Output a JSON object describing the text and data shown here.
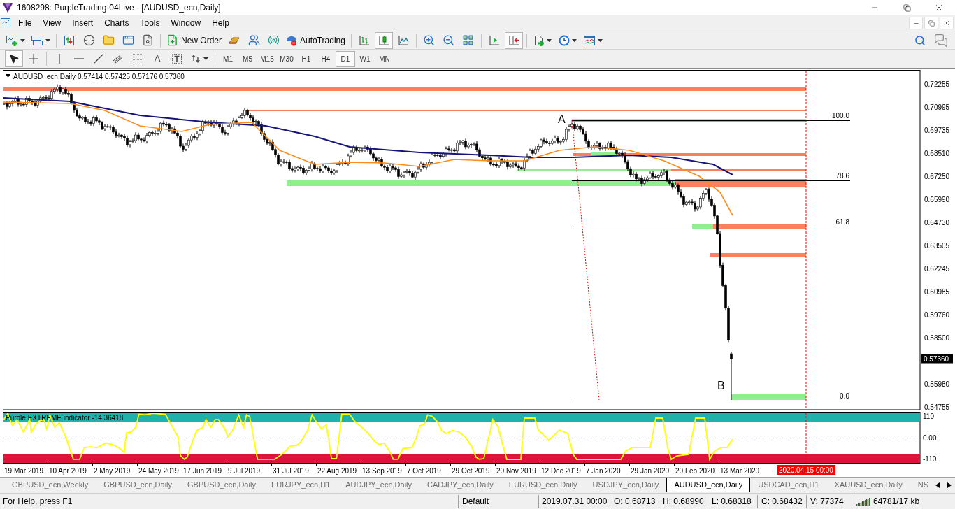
{
  "window": {
    "title": "1608298: PurpleTrading-04Live - [AUDUSD_ecn,Daily]"
  },
  "menu": [
    "File",
    "View",
    "Insert",
    "Charts",
    "Tools",
    "Window",
    "Help"
  ],
  "toolbar": {
    "new_order": "New Order",
    "auto_trading": "AutoTrading",
    "chart_types": [
      {
        "kind": "bars",
        "selected": false
      },
      {
        "kind": "candles",
        "selected": true
      },
      {
        "kind": "line",
        "selected": false
      }
    ],
    "auto_scroll": {
      "on": false
    },
    "chart_shift": {
      "on": true
    }
  },
  "drawing_toolbar": {
    "cursors": [
      {
        "kind": "arrow",
        "selected": true
      },
      {
        "kind": "crosshair",
        "selected": false
      }
    ],
    "text_tool": "A"
  },
  "timeframes": [
    {
      "label": "M1",
      "selected": false
    },
    {
      "label": "M5",
      "selected": false
    },
    {
      "label": "M15",
      "selected": false
    },
    {
      "label": "M30",
      "selected": false
    },
    {
      "label": "H1",
      "selected": false
    },
    {
      "label": "H4",
      "selected": false
    },
    {
      "label": "D1",
      "selected": true
    },
    {
      "label": "W1",
      "selected": false
    },
    {
      "label": "MN",
      "selected": false
    }
  ],
  "chart": {
    "symbol": "AUDUSD_ecn,Daily",
    "ohlc": "0.57414 0.57425 0.57176 0.57360",
    "price_ticks": [
      "0.72255",
      "0.70995",
      "0.69735",
      "0.68510",
      "0.67250",
      "0.65990",
      "0.64730",
      "0.63505",
      "0.62245",
      "0.60985",
      "0.59760",
      "0.58500",
      "0.55980",
      "0.54755"
    ],
    "current_price": "0.57360",
    "fib_levels": [
      "100.0",
      "78.6",
      "61.8",
      "0.0"
    ],
    "swing_points": [
      "A",
      "B"
    ],
    "date_ticks": [
      "19 Mar 2019",
      "10 Apr 2019",
      "2 May 2019",
      "24 May 2019",
      "17 Jun 2019",
      "9 Jul 2019",
      "31 Jul 2019",
      "22 Aug 2019",
      "13 Sep 2019",
      "7 Oct 2019",
      "29 Oct 2019",
      "20 Nov 2019",
      "12 Dec 2019",
      "7 Jan 2020",
      "29 Jan 2020",
      "20 Feb 2020",
      "13 Mar 2020"
    ],
    "date_marker": "2020.04.15 00:00"
  },
  "indicator": {
    "label": "Purple EXTREME indicator -14.36418",
    "ticks": [
      "110",
      "0.00",
      "-110"
    ]
  },
  "tabs": [
    {
      "label": "GBPUSD_ecn,Weekly",
      "selected": false
    },
    {
      "label": "GBPUSD_ecn,Daily",
      "selected": false
    },
    {
      "label": "GBPUSD_ecn,Daily",
      "selected": false
    },
    {
      "label": "EURJPY_ecn,H1",
      "selected": false
    },
    {
      "label": "AUDJPY_ecn,Daily",
      "selected": false
    },
    {
      "label": "CADJPY_ecn,Daily",
      "selected": false
    },
    {
      "label": "EURUSD_ecn,Daily",
      "selected": false
    },
    {
      "label": "USDJPY_ecn,Daily",
      "selected": false
    },
    {
      "label": "AUDUSD_ecn,Daily",
      "selected": true
    },
    {
      "label": "USDCAD_ecn,H1",
      "selected": false
    },
    {
      "label": "XAUUSD_ecn,Daily",
      "selected": false
    },
    {
      "label": "NS",
      "selected": false
    }
  ],
  "status_bar": {
    "help": "For Help, press F1",
    "profile": "Default",
    "time": "2019.07.31 00:00",
    "open": "O: 0.68713",
    "high": "H: 0.68990",
    "low": "L: 0.68318",
    "close": "C: 0.68432",
    "volume": "V: 77374",
    "traffic": "64781/17 kb"
  }
}
